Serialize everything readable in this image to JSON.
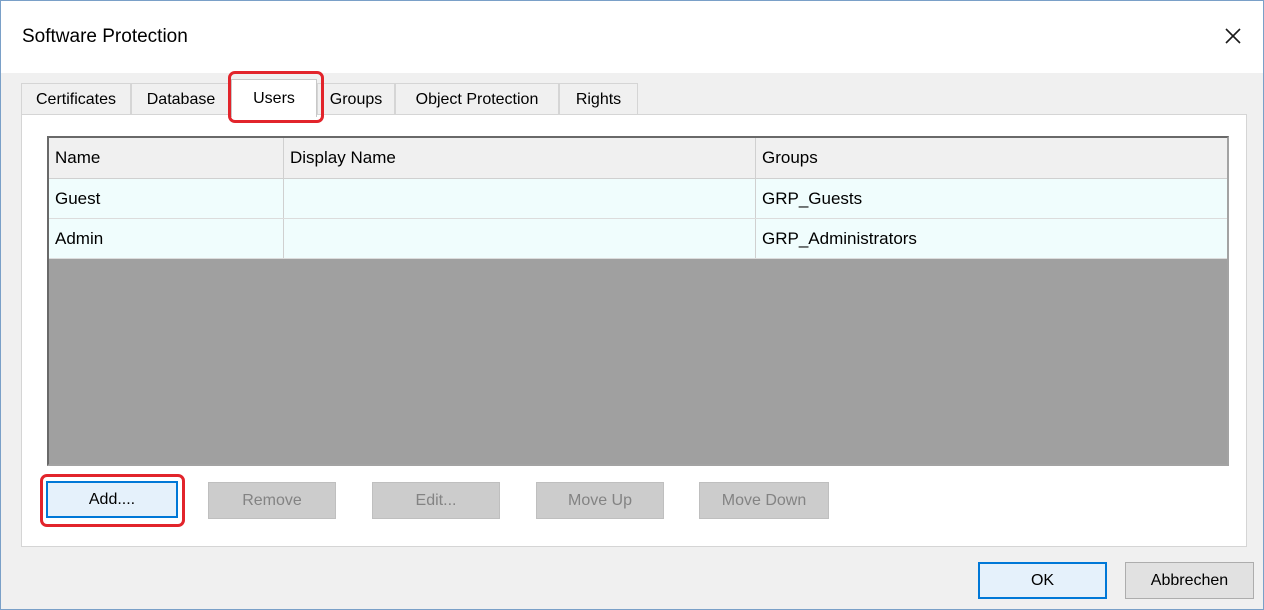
{
  "window": {
    "title": "Software Protection",
    "close_icon": "close-icon"
  },
  "tabs": [
    {
      "label": "Certificates",
      "active": false
    },
    {
      "label": "Database",
      "active": false
    },
    {
      "label": "Users",
      "active": true
    },
    {
      "label": "Groups",
      "active": false
    },
    {
      "label": "Object Protection",
      "active": false
    },
    {
      "label": "Rights",
      "active": false
    }
  ],
  "users_table": {
    "columns": [
      "Name",
      "Display Name",
      "Groups"
    ],
    "rows": [
      [
        "Guest",
        "",
        "GRP_Guests"
      ],
      [
        "Admin",
        "",
        "GRP_Administrators"
      ]
    ]
  },
  "actions": {
    "add": "Add....",
    "remove": "Remove",
    "edit": "Edit...",
    "move_up": "Move Up",
    "move_down": "Move Down"
  },
  "footer": {
    "ok": "OK",
    "cancel": "Abbrechen"
  },
  "colors": {
    "highlight": "#e2242b",
    "focus_border": "#0078d7",
    "row_background": "#f0fdfd",
    "grid_empty": "#a0a0a0"
  }
}
